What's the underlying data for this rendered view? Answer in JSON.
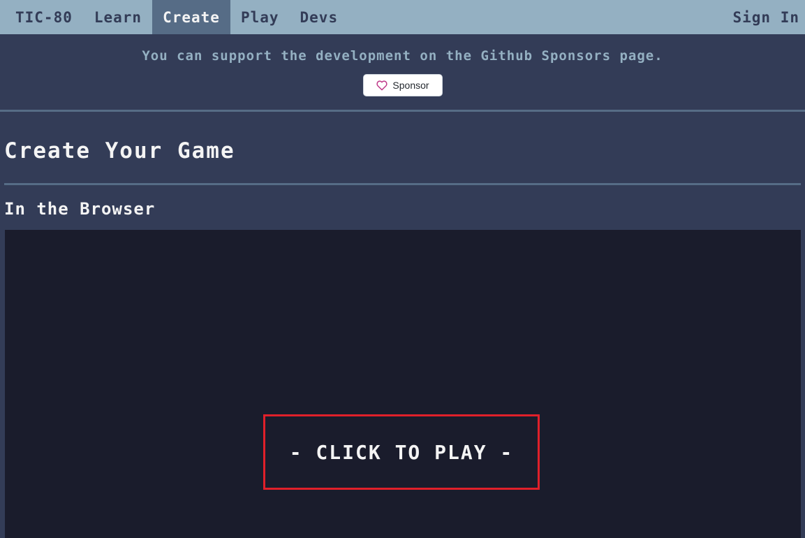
{
  "nav": {
    "brand": "TIC-80",
    "items": [
      {
        "label": "Learn"
      },
      {
        "label": "Create"
      },
      {
        "label": "Play"
      },
      {
        "label": "Devs"
      }
    ],
    "signin": "Sign In"
  },
  "sponsor": {
    "message": "You can support the development on the Github Sponsors page.",
    "button_label": "Sponsor",
    "icon": "heart-icon",
    "icon_color": "#bf3989"
  },
  "main": {
    "title": "Create Your Game",
    "section_title": "In the Browser"
  },
  "player": {
    "play_label": "- CLICK TO PLAY -"
  },
  "colors": {
    "nav_bg": "#94b0c2",
    "nav_active_bg": "#566c86",
    "page_bg": "#333c57",
    "player_bg": "#1a1c2c",
    "play_border": "#e0202a",
    "text_light": "#f4f4f4"
  }
}
